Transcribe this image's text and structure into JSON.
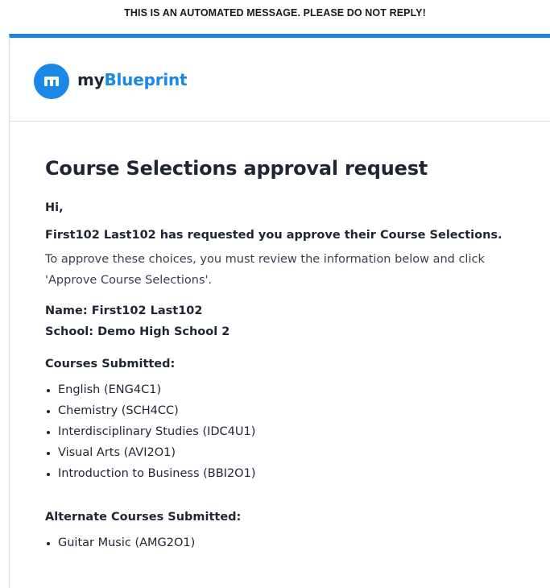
{
  "banner": "THIS IS AN AUTOMATED MESSAGE. PLEASE DO NOT REPLY!",
  "brand": {
    "prefix": "my",
    "name": "Blueprint",
    "accent": "#1b87e6"
  },
  "email": {
    "title": "Course Selections approval request",
    "greeting": "Hi,",
    "request": "First102 Last102 has requested you approve their Course Selections.",
    "instructions": "To approve these choices, you must review the information below and click 'Approve Course Selections'.",
    "name_line": "Name: First102 Last102",
    "school_line": "School: Demo High School 2",
    "courses_title": "Courses Submitted:",
    "courses": [
      "English (ENG4C1)",
      "Chemistry (SCH4CC)",
      "Interdisciplinary Studies (IDC4U1)",
      "Visual Arts (AVI2O1)",
      "Introduction to Business (BBI2O1)"
    ],
    "alternates_title": "Alternate Courses Submitted:",
    "alternates": [
      "Guitar Music (AMG2O1)"
    ]
  }
}
